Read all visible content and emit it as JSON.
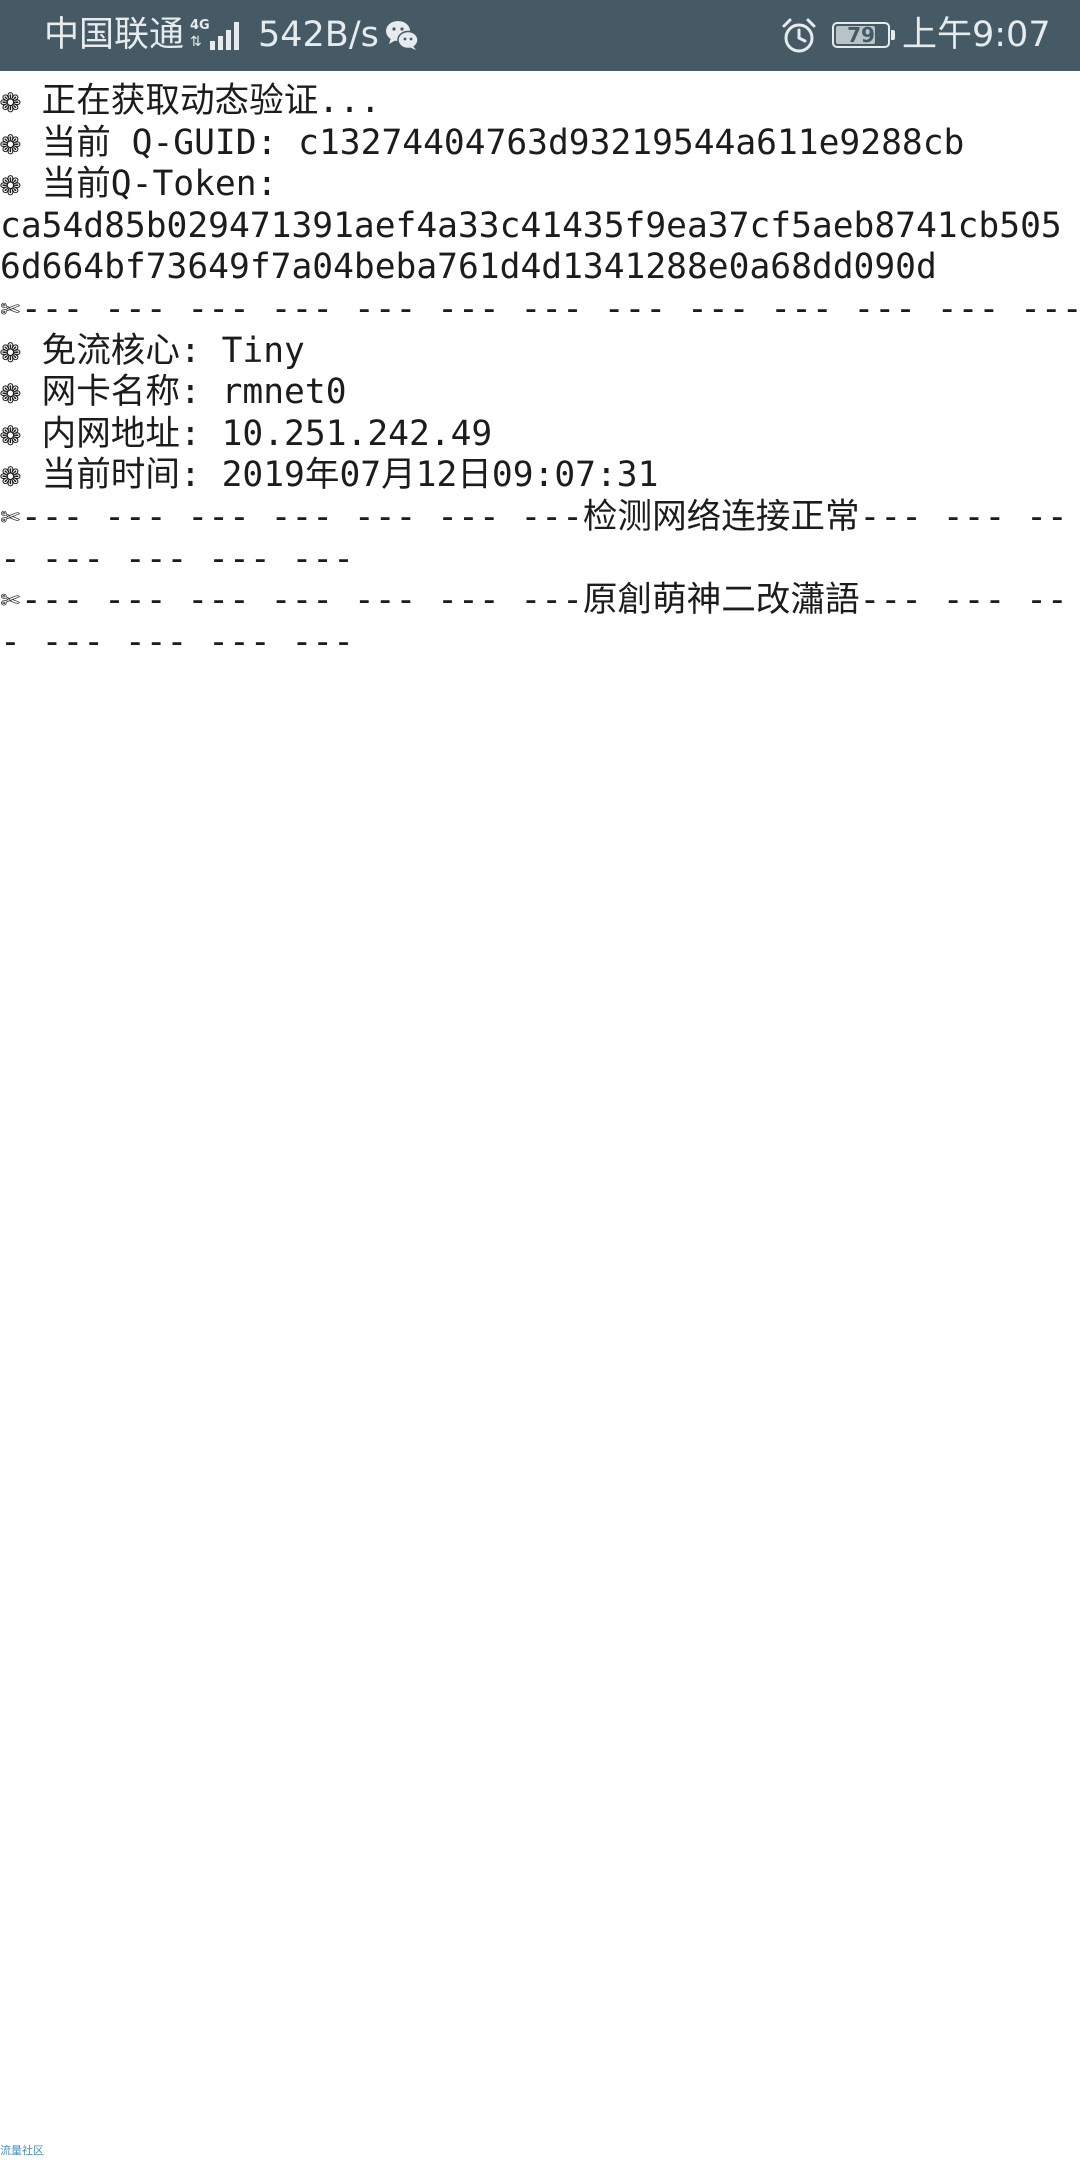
{
  "status_bar": {
    "carrier": "中国联通",
    "network_type": "4G",
    "net_speed": "542B/s",
    "battery_level": 79,
    "battery_text": "79",
    "time": "上午9:07",
    "icons": [
      "signal-icon",
      "wechat-icon",
      "alarm-icon",
      "battery-icon"
    ],
    "colors": {
      "background": "#455a64",
      "foreground": "#e6ebee"
    }
  },
  "console": {
    "bullet": "❁",
    "scissors": "✄",
    "lines": {
      "fetching": "正在获取动态验证...",
      "guid": "当前 Q-GUID: c13274404763d93219544a611e9288cb",
      "token_label": "当前Q-Token:",
      "token_value": "ca54d85b029471391aef4a33c41435f9ea37cf5aeb8741cb5056d664bf73649f7a04beba761d4d1341288e0a68dd090d",
      "separator": "--- --- --- --- --- --- --- --- --- --- --- --- --- --- ---",
      "core": "免流核心: Tiny",
      "nic": "网卡名称: rmnet0",
      "lan_ip": "内网地址: 10.251.242.49",
      "current_time": "当前时间: 2019年07月12日09:07:31",
      "network_ok": "--- --- --- --- --- --- ---检测网络连接正常--- --- --- --- --- --- ---",
      "credit": "--- --- --- --- --- --- ---原創萌神二改瀟語--- --- --- --- --- --- ---"
    },
    "text_color": "#1c1c1c"
  },
  "footer": {
    "watermark": "流量社区"
  }
}
